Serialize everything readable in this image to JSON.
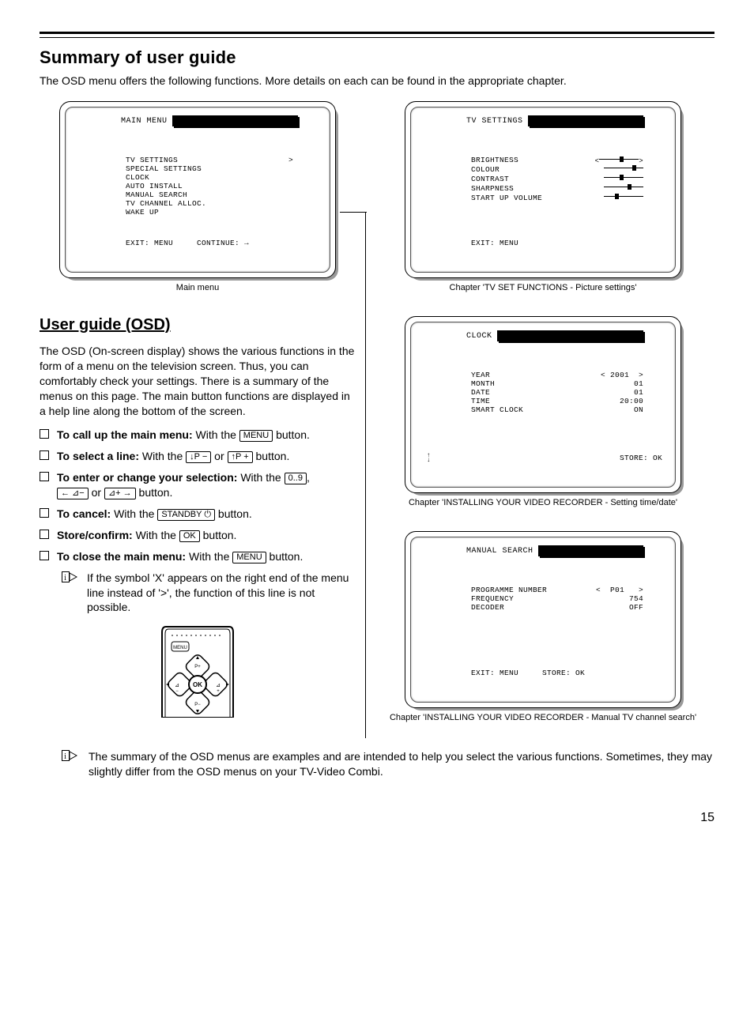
{
  "section_title": "Summary of user guide",
  "intro": "The OSD menu offers the following functions. More details on each can be found in the appropriate chapter.",
  "main_menu_screen": {
    "title": "MAIN MENU",
    "items": [
      {
        "label": "TV SETTINGS",
        "marker": ">"
      },
      {
        "label": "SPECIAL SETTINGS",
        "marker": ""
      },
      {
        "label": "CLOCK",
        "marker": ""
      },
      {
        "label": "AUTO INSTALL",
        "marker": ""
      },
      {
        "label": "MANUAL SEARCH",
        "marker": ""
      },
      {
        "label": "TV CHANNEL ALLOC.",
        "marker": ""
      },
      {
        "label": "WAKE UP",
        "marker": ""
      }
    ],
    "help_left": "EXIT: MENU",
    "help_right": "CONTINUE: →",
    "caption": "Main menu"
  },
  "tv_settings_screen": {
    "title": "TV SETTINGS",
    "items": [
      "BRIGHTNESS",
      "COLOUR",
      "CONTRAST",
      "SHARPNESS",
      "START UP VOLUME"
    ],
    "help_left": "EXIT: MENU",
    "caption": "Chapter 'TV SET FUNCTIONS - Picture settings'"
  },
  "clock_screen": {
    "title": "CLOCK",
    "rows": [
      {
        "label": "YEAR",
        "value": "< 2001  >"
      },
      {
        "label": "MONTH",
        "value": "01"
      },
      {
        "label": "DATE",
        "value": "01"
      },
      {
        "label": "TIME",
        "value": "20:00"
      },
      {
        "label": "SMART CLOCK",
        "value": "ON"
      }
    ],
    "help_right": "STORE: OK",
    "caption": "Chapter 'INSTALLING YOUR VIDEO RECORDER - Setting time/date'"
  },
  "manual_search_screen": {
    "title": "MANUAL SEARCH",
    "rows": [
      {
        "label": "PROGRAMME NUMBER",
        "value": "<  P01   >"
      },
      {
        "label": "FREQUENCY",
        "value": "754"
      },
      {
        "label": "DECODER",
        "value": "OFF"
      }
    ],
    "help_left": "EXIT: MENU",
    "help_right": "STORE: OK",
    "caption": "Chapter 'INSTALLING YOUR VIDEO RECORDER - Manual TV channel search'"
  },
  "subheading": "User guide (OSD)",
  "osd_paragraph": "The OSD (On-screen display) shows the various functions in the form of a menu on the television screen. Thus, you can comfortably check your settings. There is a summary of the menus on this page. The main button functions are displayed in a help line along the bottom of the screen.",
  "instructions": {
    "call_up_bold": "To call up the main menu:",
    "call_up_rest_a": " With the ",
    "call_up_rest_b": " button.",
    "select_bold": "To select a line:",
    "select_rest_a": " With the ",
    "select_rest_or": " or ",
    "select_rest_b": " button.",
    "enter_bold": "To enter or change your selection:",
    "enter_rest_a": " With the ",
    "cancel_bold": "To cancel:",
    "cancel_rest_a": " With the ",
    "cancel_rest_b": " button.",
    "store_bold": "Store/confirm:",
    "store_rest_a": " With the ",
    "store_rest_b": " button.",
    "close_bold": "To close the main menu:",
    "close_rest_a": " With the ",
    "close_rest_b": " button."
  },
  "keys": {
    "menu": "MENU",
    "p_minus": "↓P −",
    "p_plus": "↑P +",
    "digits": "0..9",
    "vol_minus": "← ⊿−",
    "vol_plus": "⊿+ →",
    "standby": "STANDBY ⏻",
    "ok": "OK"
  },
  "note_text": "If the symbol 'X' appears on the right end of the menu line instead of '>', the function of this line is not possible.",
  "footer_note": "The summary of the OSD menus are examples and are intended to help you select the various functions. Sometimes, they may slightly differ from the OSD menus on your TV-Video Combi.",
  "page_number": "15",
  "remote_label_menu": "MENU",
  "remote_label_ok": "OK",
  "remote_label_pplus": "P+",
  "remote_label_pminus": "P−"
}
